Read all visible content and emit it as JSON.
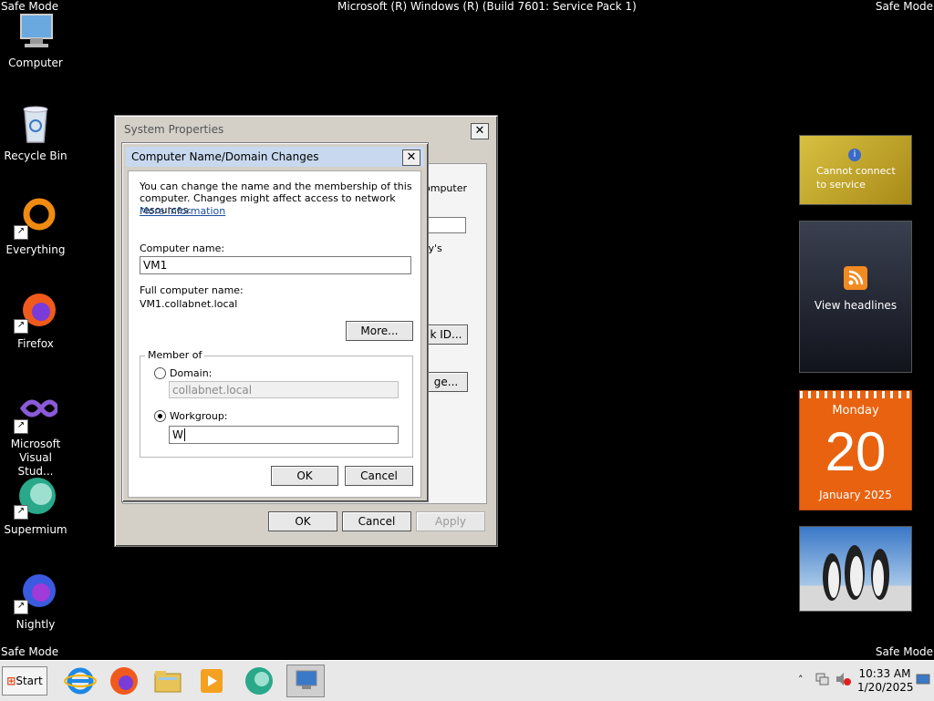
{
  "desktop": {
    "top_left": "Safe Mode",
    "top_center": "Microsoft (R) Windows (R) (Build 7601: Service Pack 1)",
    "top_right": "Safe Mode",
    "bottom_left": "Safe Mode",
    "bottom_right": "Safe Mode",
    "icons": [
      {
        "label": "Computer",
        "icon": "computer-icon"
      },
      {
        "label": "Recycle Bin",
        "icon": "recycle-bin-icon"
      },
      {
        "label": "Everything",
        "icon": "everything-icon"
      },
      {
        "label": "Firefox",
        "icon": "firefox-icon"
      },
      {
        "label": "Microsoft Visual Stud...",
        "icon": "visual-studio-icon"
      },
      {
        "label": "Supermium",
        "icon": "supermium-icon"
      },
      {
        "label": "Nightly",
        "icon": "nightly-icon"
      }
    ]
  },
  "system_properties": {
    "title": "System Properties",
    "partial_texts": [
      "omputer",
      "ry's",
      "k ID...",
      "ge..."
    ],
    "ok": "OK",
    "cancel": "Cancel",
    "apply": "Apply"
  },
  "name_change": {
    "title": "Computer Name/Domain Changes",
    "intro": "You can change the name and the membership of this computer. Changes might affect access to network resources.",
    "more_info_link": "More information",
    "computer_name_label": "Computer name:",
    "computer_name_value": "VM1",
    "full_name_label": "Full computer name:",
    "full_name_value": "VM1.collabnet.local",
    "more_button": "More...",
    "member_of_label": "Member of",
    "domain_label": "Domain:",
    "domain_value": "collabnet.local",
    "workgroup_label": "Workgroup:",
    "workgroup_value": "W",
    "selected_membership": "Workgroup",
    "ok": "OK",
    "cancel": "Cancel"
  },
  "gadgets": {
    "weather_text": "Cannot connect to service",
    "feed_text": "View headlines",
    "calendar": {
      "weekday": "Monday",
      "day": "20",
      "month_year": "January 2025"
    }
  },
  "taskbar": {
    "start": "Start",
    "apps": [
      "internet-explorer-icon",
      "firefox-icon",
      "file-explorer-icon",
      "media-player-icon",
      "supermium-icon",
      "system-properties-icon"
    ],
    "clock_time": "10:33 AM",
    "clock_date": "1/20/2025"
  },
  "colors": {
    "calendar_orange": "#e8620f",
    "weather_gold": "#c8aa2a",
    "rss_orange": "#f28a22"
  }
}
